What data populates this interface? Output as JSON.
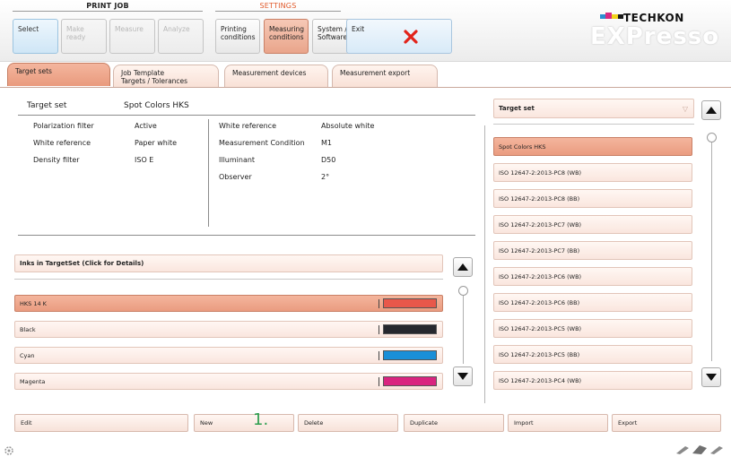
{
  "header": {
    "print_job_title": "PRINT JOB",
    "settings_title": "SETTINGS",
    "print_job_buttons": [
      {
        "label": "Select",
        "state": "selected"
      },
      {
        "label": "Make ready",
        "state": "disabled"
      },
      {
        "label": "Measure",
        "state": "disabled"
      },
      {
        "label": "Analyze",
        "state": "disabled"
      }
    ],
    "settings_buttons": [
      {
        "label": "Printing\nconditions",
        "state": "normal"
      },
      {
        "label": "Measuring\nconditions",
        "state": "selected"
      },
      {
        "label": "System /\nSoftware",
        "state": "normal"
      }
    ],
    "exit_label": "Exit",
    "exit_icon": "close-x-icon",
    "brand_name": "TECHKON",
    "product_name": "EXPresso",
    "colors": {
      "accent_orange": "#e99a7d",
      "exit_red": "#e2231a",
      "settings_title": "#e05a2b",
      "callout_green": "#2e9e4f"
    }
  },
  "tabs": [
    {
      "label": "Target sets",
      "active": true
    },
    {
      "label": "Job Template\nTargets / Tolerances",
      "active": false
    },
    {
      "label": "Measurement devices",
      "active": false
    },
    {
      "label": "Measurement export",
      "active": false
    }
  ],
  "target_set": {
    "label": "Target set",
    "value": "Spot Colors HKS",
    "left_props": [
      {
        "label": "Polarization filter",
        "value": "Active"
      },
      {
        "label": "White reference",
        "value": "Paper white"
      },
      {
        "label": "Density filter",
        "value": "ISO E"
      }
    ],
    "right_props": [
      {
        "label": "White reference",
        "value": "Absolute white"
      },
      {
        "label": "Measurement Condition",
        "value": "M1"
      },
      {
        "label": "Illuminant",
        "value": "D50"
      },
      {
        "label": "Observer",
        "value": "2°"
      }
    ]
  },
  "inks": {
    "header": "Inks in TargetSet (Click for Details)",
    "items": [
      {
        "name": "HKS 14 K",
        "color": "#e8574a",
        "selected": true
      },
      {
        "name": "Black",
        "color": "#26282e",
        "selected": false
      },
      {
        "name": "Cyan",
        "color": "#1a8fd8",
        "selected": false
      },
      {
        "name": "Magenta",
        "color": "#d9247f",
        "selected": false
      }
    ]
  },
  "target_list": {
    "dropdown_label": "Target set",
    "items": [
      {
        "label": "Spot Colors HKS",
        "selected": true
      },
      {
        "label": "ISO 12647-2:2013-PC8 (WB)",
        "selected": false
      },
      {
        "label": "ISO 12647-2:2013-PC8 (BB)",
        "selected": false
      },
      {
        "label": "ISO 12647-2:2013-PC7 (WB)",
        "selected": false
      },
      {
        "label": "ISO 12647-2:2013-PC7 (BB)",
        "selected": false
      },
      {
        "label": "ISO 12647-2:2013-PC6 (WB)",
        "selected": false
      },
      {
        "label": "ISO 12647-2:2013-PC6 (BB)",
        "selected": false
      },
      {
        "label": "ISO 12647-2:2013-PC5 (WB)",
        "selected": false
      },
      {
        "label": "ISO 12647-2:2013-PC5 (BB)",
        "selected": false
      },
      {
        "label": "ISO 12647-2:2013-PC4 (WB)",
        "selected": false
      }
    ]
  },
  "bottom_buttons": [
    "Edit",
    "New",
    "Delete",
    "Duplicate",
    "Import",
    "Export"
  ],
  "callout": "1."
}
